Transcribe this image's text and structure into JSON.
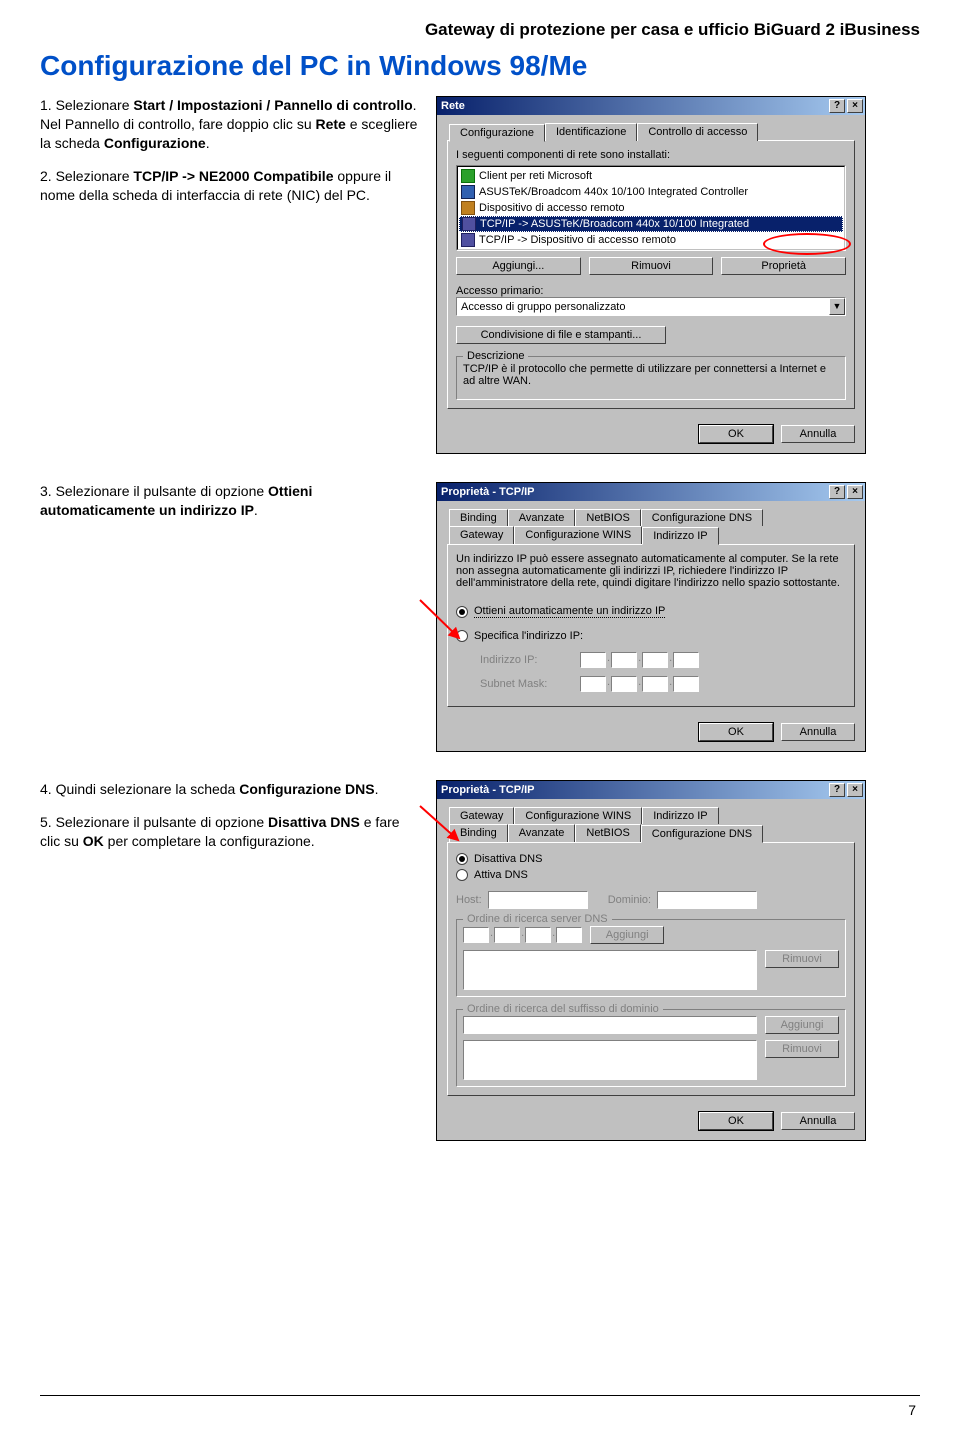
{
  "header": "Gateway di protezione per casa e ufficio BiGuard 2 iBusiness",
  "title": "Configurazione del PC in Windows 98/Me",
  "page_num": "7",
  "section1": {
    "step1_prefix": "1. Selezionare ",
    "step1_bold": "Start / Impostazioni / Pannello di controllo",
    "step1_after": ". Nel Pannello di controllo, fare doppio clic su ",
    "step1_bold2": "Rete",
    "step1_after2": " e scegliere la scheda ",
    "step1_bold3": "Configurazione",
    "step1_end": ".",
    "step2_prefix": "2. Selezionare ",
    "step2_bold": "TCP/IP -> NE2000 Compatibile",
    "step2_after": " oppure il nome della scheda di interfaccia di rete (NIC) del PC."
  },
  "dlg1": {
    "title": "Rete",
    "tab1": "Configurazione",
    "tab2": "Identificazione",
    "tab3": "Controllo di accesso",
    "label_components": "I seguenti componenti di rete sono installati:",
    "items": [
      {
        "icon": "net",
        "text": "Client per reti Microsoft"
      },
      {
        "icon": "card",
        "text": "ASUSTeK/Broadcom 440x 10/100 Integrated Controller"
      },
      {
        "icon": "dial",
        "text": "Dispositivo di accesso remoto"
      },
      {
        "icon": "tcp",
        "text": "TCP/IP -> ASUSTeK/Broadcom 440x 10/100 Integrated",
        "selected": true
      },
      {
        "icon": "tcp",
        "text": "TCP/IP -> Dispositivo di accesso remoto"
      }
    ],
    "btn_add": "Aggiungi...",
    "btn_remove": "Rimuovi",
    "btn_props": "Proprietà",
    "label_primary": "Accesso primario:",
    "primary_value": "Accesso di gruppo personalizzato",
    "btn_share": "Condivisione di file e stampanti...",
    "group_desc": "Descrizione",
    "desc_text": "TCP/IP è il protocollo che permette di utilizzare per connettersi a Internet e ad altre WAN.",
    "btn_ok": "OK",
    "btn_cancel": "Annulla"
  },
  "section2": {
    "step3_prefix": "3. Selezionare il pulsante di opzione ",
    "step3_bold": "Ottieni automaticamente un indirizzo IP",
    "step3_end": "."
  },
  "dlg2": {
    "title": "Proprietà - TCP/IP",
    "tabs_r1": [
      "Binding",
      "Avanzate",
      "NetBIOS",
      "Configurazione DNS"
    ],
    "tabs_r2": [
      "Gateway",
      "Configurazione WINS",
      "Indirizzo IP"
    ],
    "desc": "Un indirizzo IP può essere assegnato automaticamente al computer. Se la rete non assegna automaticamente gli indirizzi IP, richiedere l'indirizzo IP dell'amministratore della rete, quindi digitare l'indirizzo nello spazio sottostante.",
    "opt_auto": "Ottieni automaticamente un indirizzo IP",
    "opt_manual": "Specifica l'indirizzo IP:",
    "lbl_ip": "Indirizzo IP:",
    "lbl_mask": "Subnet Mask:",
    "btn_ok": "OK",
    "btn_cancel": "Annulla"
  },
  "section3": {
    "step4_prefix": "4. Quindi selezionare la scheda ",
    "step4_bold": "Configurazione DNS",
    "step4_end": ".",
    "step5_prefix": "5. Selezionare il pulsante di opzione ",
    "step5_bold": "Disattiva DNS",
    "step5_mid": " e fare clic su ",
    "step5_bold2": "OK",
    "step5_end": " per completare la configurazione."
  },
  "dlg3": {
    "title": "Proprietà - TCP/IP",
    "tabs_r1": [
      "Gateway",
      "Configurazione WINS",
      "Indirizzo IP"
    ],
    "tabs_r2": [
      "Binding",
      "Avanzate",
      "NetBIOS",
      "Configurazione DNS"
    ],
    "opt_disable": "Disattiva DNS",
    "opt_enable": "Attiva DNS",
    "lbl_host": "Host:",
    "lbl_domain": "Dominio:",
    "lbl_search": "Ordine di ricerca server DNS",
    "btn_agg": "Aggiungi",
    "btn_rim": "Rimuovi",
    "lbl_suffix": "Ordine di ricerca del suffisso di dominio",
    "btn_ok": "OK",
    "btn_cancel": "Annulla"
  }
}
